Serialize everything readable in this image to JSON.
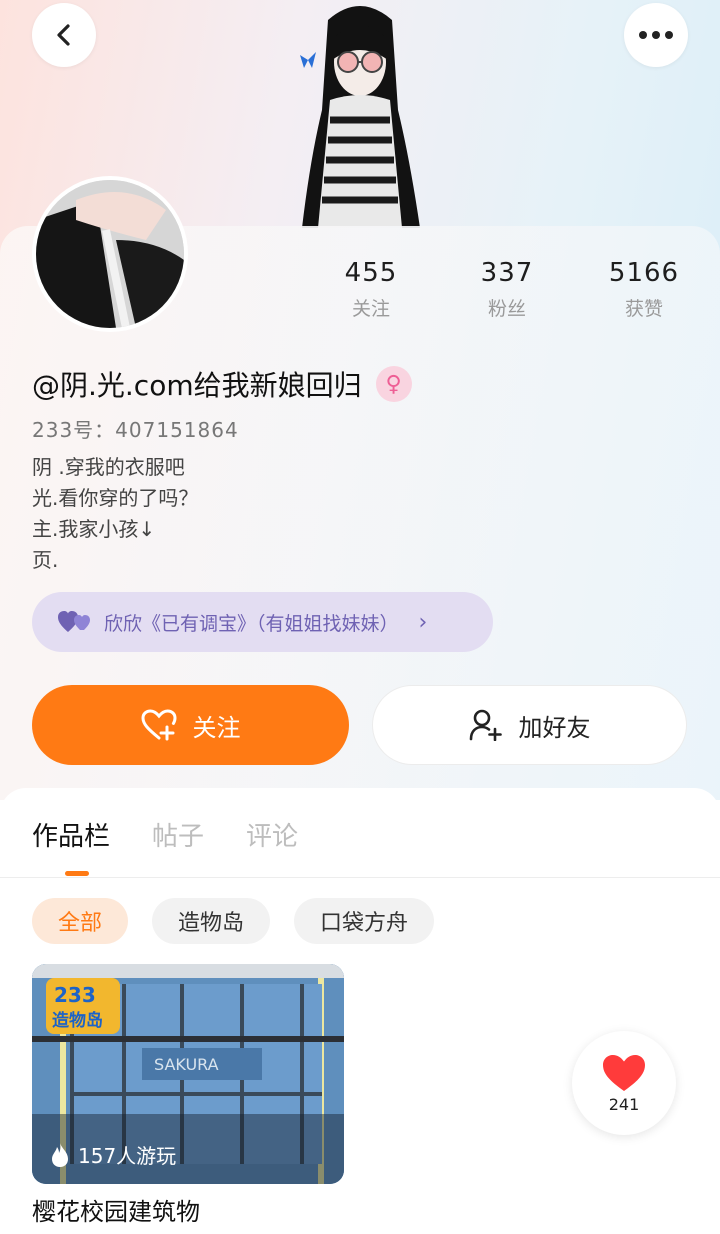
{
  "header": {
    "back_icon": "chevron-left-icon",
    "more_icon": "more-dots-icon"
  },
  "stats": [
    {
      "num": "455",
      "label": "关注"
    },
    {
      "num": "337",
      "label": "粉丝"
    },
    {
      "num": "5166",
      "label": "获赞"
    }
  ],
  "profile": {
    "nickname": "@阴.光.com给我新娘回归",
    "gender_icon": "female-icon",
    "uid": "233号：407151864",
    "bio": [
      "阴 .穿我的衣服吧",
      "光.看你穿的了吗？",
      "主.我家小孩↓",
      "页."
    ]
  },
  "relation": {
    "icon": "double-heart-icon",
    "text": "欣欣《已有调宝》（有姐姐找妹妹）"
  },
  "actions": {
    "follow_label": "关注",
    "add_friend_label": "加好友"
  },
  "tabs": [
    "作品栏",
    "帖子",
    "评论"
  ],
  "chips": [
    "全部",
    "造物岛",
    "口袋方舟"
  ],
  "work": {
    "badge_line1": "233",
    "badge_line2": "造物岛",
    "sign_text": "SAKURA",
    "play_count": "157人游玩",
    "title": "樱花校园建筑物"
  },
  "like": {
    "count": "241"
  },
  "colors": {
    "accent": "#ff7a14",
    "relation_bg": "#e3ddf2",
    "relation_text": "#6f62b3",
    "like": "#ff3b3b"
  }
}
